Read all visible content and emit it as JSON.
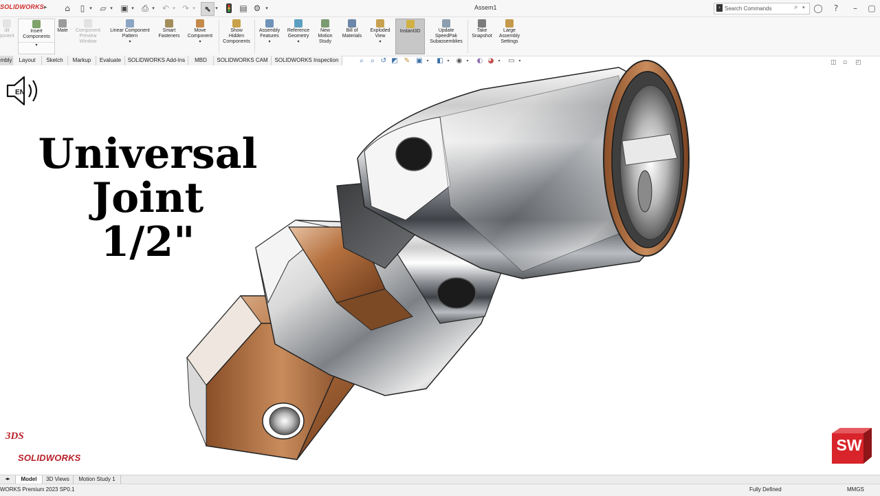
{
  "app": {
    "logo_text": "SOLIDWORKS",
    "document_title": "Assem1"
  },
  "search": {
    "placeholder": "Search Commands"
  },
  "ribbon": {
    "buttons": [
      {
        "label_1": "dit",
        "label_2": "ponent",
        "label_3": ""
      },
      {
        "label_1": "Insert",
        "label_2": "Components",
        "label_3": ""
      },
      {
        "label_1": "Mate",
        "label_2": "",
        "label_3": ""
      },
      {
        "label_1": "Component",
        "label_2": "Preview",
        "label_3": "Window"
      },
      {
        "label_1": "Linear Component",
        "label_2": "Pattern",
        "label_3": ""
      },
      {
        "label_1": "Smart",
        "label_2": "Fasteners",
        "label_3": ""
      },
      {
        "label_1": "Move",
        "label_2": "Component",
        "label_3": ""
      },
      {
        "label_1": "Show",
        "label_2": "Hidden",
        "label_3": "Components"
      },
      {
        "label_1": "Assembly",
        "label_2": "Features",
        "label_3": ""
      },
      {
        "label_1": "Reference",
        "label_2": "Geometry",
        "label_3": ""
      },
      {
        "label_1": "New",
        "label_2": "Motion",
        "label_3": "Study"
      },
      {
        "label_1": "Bill of",
        "label_2": "Materials",
        "label_3": ""
      },
      {
        "label_1": "Exploded",
        "label_2": "View",
        "label_3": ""
      },
      {
        "label_1": "Instant3D",
        "label_2": "",
        "label_3": ""
      },
      {
        "label_1": "Update",
        "label_2": "SpeedPak",
        "label_3": "Subassemblies"
      },
      {
        "label_1": "Take",
        "label_2": "Snapshot",
        "label_3": ""
      },
      {
        "label_1": "Large",
        "label_2": "Assembly",
        "label_3": "Settings"
      }
    ]
  },
  "command_tabs": [
    "mbly",
    "Layout",
    "Sketch",
    "Markup",
    "Evaluate",
    "SOLIDWORKS Add-Ins",
    "MBD",
    "SOLIDWORKS CAM",
    "SOLIDWORKS Inspection"
  ],
  "overlay": {
    "language_badge": "EN",
    "title_line_1": "Universal",
    "title_line_2": "Joint",
    "title_line_3": "1/2\"",
    "ds_mark": "3DS",
    "ds_brand": "SOLIDWORKS",
    "sw_badge": "SW"
  },
  "bottom_tabs": [
    "Model",
    "3D Views",
    "Motion Study 1"
  ],
  "status": {
    "product": "WORKS Premium 2023 SP0.1",
    "state": "Fully Defined",
    "units": "MMGS"
  },
  "icons": {
    "speaker": "speaker-icon",
    "search": "search-icon",
    "home": "home-icon",
    "new": "new-document-icon",
    "open": "open-folder-icon",
    "save": "save-icon",
    "print": "print-icon",
    "undo": "undo-icon",
    "redo": "redo-icon",
    "select": "select-arrow-icon",
    "traffic_light": "rebuild-icon",
    "file_props": "file-properties-icon",
    "options": "gear-icon",
    "user": "user-icon",
    "help": "help-icon"
  },
  "colors": {
    "brand_red": "#d12a2a",
    "ribbon_bg": "#f7f7f7",
    "copper": "#b06a3c",
    "chrome": "#9aa0a6"
  }
}
